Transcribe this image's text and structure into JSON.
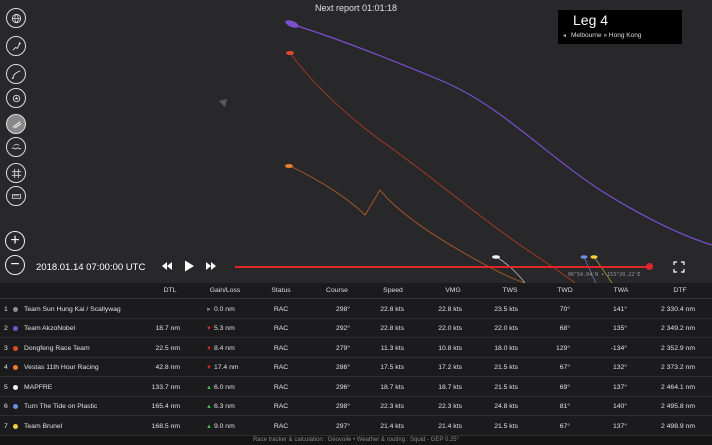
{
  "header": {
    "next_report": "Next report 01:01:18"
  },
  "leg": {
    "title": "Leg 4",
    "route": "Melbourne » Hong Kong"
  },
  "toolbar": {
    "tools": [
      {
        "icon": "globe-icon"
      },
      {
        "icon": "boat-track-icon"
      },
      {
        "icon": "route-icon"
      },
      {
        "icon": "boat-badge-icon"
      },
      {
        "icon": "wind-layer-icon",
        "active": true
      },
      {
        "icon": "wave-layer-icon"
      },
      {
        "icon": "grid-icon"
      },
      {
        "icon": "ruler-icon"
      }
    ]
  },
  "playback": {
    "timestamp": "2018.01.14 07:00:00 UTC",
    "progress": 0.99,
    "coords": "06°54.04'N • 153°20.22'E"
  },
  "table": {
    "columns": [
      "DTL",
      "Gain/Loss",
      "Status",
      "Course",
      "Speed",
      "VMG",
      "TWS",
      "TWD",
      "TWA",
      "DTF"
    ],
    "rows": [
      {
        "rank": "1",
        "color": "#8e8e8e",
        "team": "Team Sun Hung Kai / Scallywag",
        "dtl": "",
        "gl_dir": "flat",
        "gl": "0.0 nm",
        "status": "RAC",
        "course": "298°",
        "speed": "22.8 kts",
        "vmg": "22.8 kts",
        "tws": "23.5 kts",
        "twd": "70°",
        "twa": "141°",
        "dtf": "2 330.4 nm"
      },
      {
        "rank": "2",
        "color": "#7a4fd0",
        "team": "Team AkzoNobel",
        "dtl": "18.7 nm",
        "gl_dir": "down",
        "gl": "5.3 nm",
        "status": "RAC",
        "course": "292°",
        "speed": "22.8 kts",
        "vmg": "22.0 kts",
        "tws": "22.0 kts",
        "twd": "68°",
        "twa": "135°",
        "dtf": "2 349.2 nm"
      },
      {
        "rank": "3",
        "color": "#e24a2c",
        "team": "Dongfeng Race Team",
        "dtl": "22.5 nm",
        "gl_dir": "down",
        "gl": "8.4 nm",
        "status": "RAC",
        "course": "279°",
        "speed": "11.3 kts",
        "vmg": "10.8 kts",
        "tws": "18.0 kts",
        "twd": "129°",
        "twa": "-134°",
        "dtf": "2 352.9 nm"
      },
      {
        "rank": "4",
        "color": "#ef7d2e",
        "team": "Vestas 11th Hour Racing",
        "dtl": "42.8 nm",
        "gl_dir": "down",
        "gl": "17.4 nm",
        "status": "RAC",
        "course": "286°",
        "speed": "17.5 kts",
        "vmg": "17.2 kts",
        "tws": "21.5 kts",
        "twd": "67°",
        "twa": "132°",
        "dtf": "2 373.2 nm"
      },
      {
        "rank": "5",
        "color": "#f2f2f2",
        "team": "MAPFRE",
        "dtl": "133.7 nm",
        "gl_dir": "up",
        "gl": "6.0 nm",
        "status": "RAC",
        "course": "296°",
        "speed": "18.7 kts",
        "vmg": "18.7 kts",
        "tws": "21.5 kts",
        "twd": "69°",
        "twa": "137°",
        "dtf": "2 464.1 nm"
      },
      {
        "rank": "6",
        "color": "#6f8fe0",
        "team": "Turn The Tide on Plastic",
        "dtl": "165.4 nm",
        "gl_dir": "up",
        "gl": "6.3 nm",
        "status": "RAC",
        "course": "298°",
        "speed": "22.3 kts",
        "vmg": "22.3 kts",
        "tws": "24.8 kts",
        "twd": "81°",
        "twa": "140°",
        "dtf": "2 495.8 nm"
      },
      {
        "rank": "7",
        "color": "#f0d23a",
        "team": "Team Brunel",
        "dtl": "168.5 nm",
        "gl_dir": "up",
        "gl": "9.0 nm",
        "status": "RAC",
        "course": "297°",
        "speed": "21.4 kts",
        "vmg": "21.4 kts",
        "tws": "21.5 kts",
        "twd": "67°",
        "twa": "137°",
        "dtf": "2 498.9 nm"
      }
    ]
  },
  "footer": {
    "credits": "Race tracker & calculation : Géovoile • Weather & routing : Squid - GEP 0.25°"
  },
  "colors": {
    "progress": "#e1262b",
    "gain": "#3fbf4f",
    "loss": "#e1262b"
  }
}
